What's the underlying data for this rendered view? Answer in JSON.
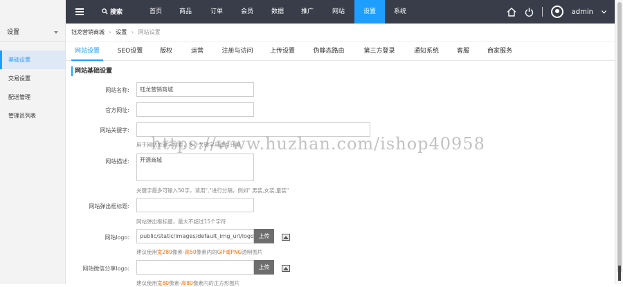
{
  "topnav": {
    "search_label": "搜索",
    "items": [
      "首页",
      "商品",
      "订单",
      "会员",
      "数据",
      "推广",
      "网站",
      "设置",
      "系统"
    ],
    "active": "设置",
    "user": "admin"
  },
  "sidebar": {
    "title": "设置",
    "items": [
      "基础设置",
      "交易设置",
      "配送管理",
      "管理员列表"
    ]
  },
  "breadcrumb": [
    "钰龙营销商城",
    "设置",
    "网站设置"
  ],
  "tabs": [
    "网站设置",
    "SEO设置",
    "版权",
    "运营",
    "注册与访问",
    "上传设置",
    "伪静态路由",
    "第三方登录",
    "通知系统",
    "客服",
    "商家服务"
  ],
  "section_title": "网站基础设置",
  "form": {
    "site_name_label": "网站名称:",
    "site_name_value": "钰龙营销商城",
    "official_url_label": "官方网址:",
    "keywords_label": "网站关键字:",
    "keywords_hint": "用于网站关键字搜索，多个关键字用逗号分隔",
    "desc_label": "网站描述:",
    "desc_value": "开源商城",
    "desc_hint": "关键字最多可输入50字，请用\",\"进行分隔，例如\" 男装,女装,童装\"",
    "popup_label": "网站弹出框标题:",
    "popup_hint": "网站弹出框标题，最大不超过15个字符",
    "logo_label": "网站logo:",
    "logo_value": "public/static/images/default_img_url/logo.png",
    "upload_label": "上传",
    "logo_hint_pre": "建议使用",
    "logo_hint_w": "宽280",
    "logo_hint_mid": "像素-",
    "logo_hint_h": "高50",
    "logo_hint_mid2": "像素内的",
    "logo_hint_fmt": "GIF或PNG",
    "logo_hint_post": "透明图片",
    "wechat_label": "网站微信分享logo:",
    "wechat_hint_pre": "建议使用",
    "wechat_hint_w": "宽80",
    "wechat_hint_mid": "像素-",
    "wechat_hint_h": "高80",
    "wechat_hint_post": "像素内的正方形图片"
  },
  "watermark": "https://www.huzhan.com/ishop40958",
  "colors": {
    "accent": "#1e9fff",
    "topbar": "#393d49",
    "orange": "#ff6a00"
  }
}
